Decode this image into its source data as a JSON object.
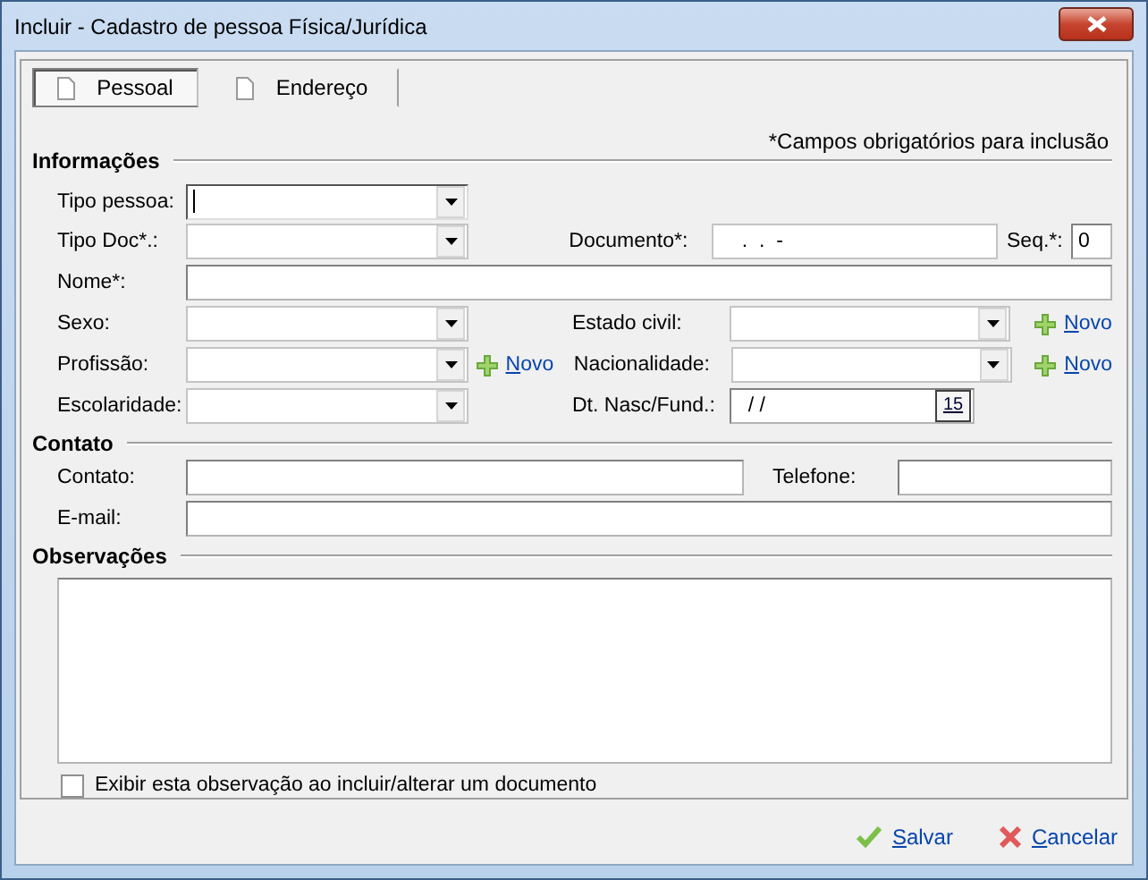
{
  "window": {
    "title": "Incluir - Cadastro de pessoa Física/Jurídica"
  },
  "tabs": [
    {
      "label": "Pessoal",
      "selected": true
    },
    {
      "label": "Endereço",
      "selected": false
    }
  ],
  "informacoes": {
    "title": "Informações",
    "required_note": "*Campos obrigatórios para inclusão",
    "tipo_pessoa": {
      "label": "Tipo pessoa:",
      "focused": true
    },
    "tipo_doc": {
      "label": "Tipo Doc*.:"
    },
    "documento": {
      "label": "Documento*:",
      "value": ".  .  -"
    },
    "seq": {
      "label": "Seq.*:",
      "value": "0"
    },
    "nome": {
      "label": "Nome*:"
    },
    "sexo": {
      "label": "Sexo:"
    },
    "estado_civil": {
      "label": "Estado civil:",
      "link": "Novo"
    },
    "profissao": {
      "label": "Profissão:",
      "link": "Novo"
    },
    "nacionalidade": {
      "label": "Nacionalidade:",
      "link": "Novo"
    },
    "escolaridade": {
      "label": "Escolaridade:"
    },
    "dt_nasc": {
      "label": "Dt. Nasc/Fund.:",
      "value": "/ /",
      "calendar": "15"
    }
  },
  "contato": {
    "title": "Contato",
    "contato_label": "Contato:",
    "telefone_label": "Telefone:",
    "email_label": "E-mail:"
  },
  "observacoes": {
    "title": "Observações",
    "checkbox": {
      "label": "Exibir esta observação ao incluir/alterar um documento",
      "checked": false
    }
  },
  "buttons": [
    {
      "label": "Salvar",
      "kind": "save"
    },
    {
      "label": "Cancelar",
      "kind": "cancel"
    }
  ]
}
